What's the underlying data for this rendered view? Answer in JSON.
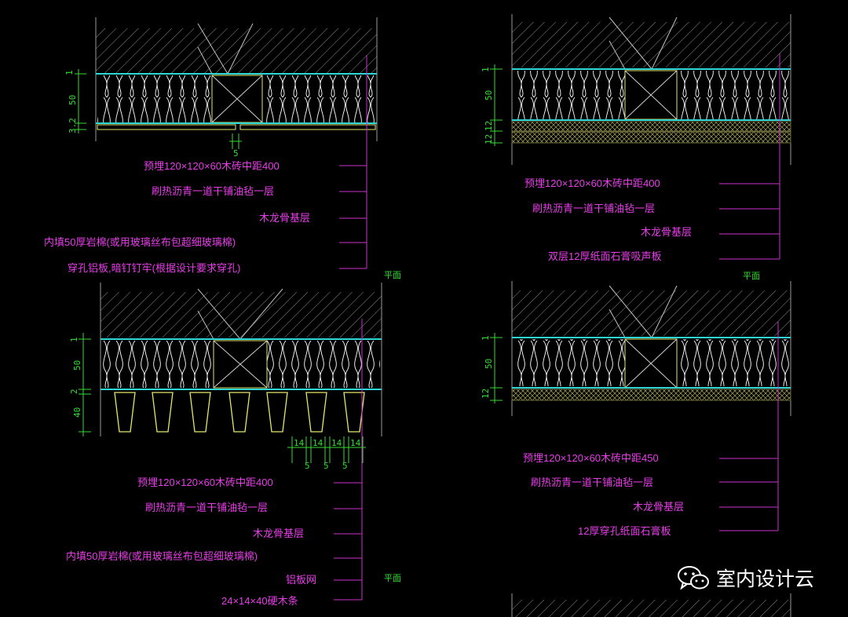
{
  "colors": {
    "background": "#000000",
    "structure": "#9a9a9a",
    "insulation": "#ffffff",
    "membrane": "#2fd6d6",
    "wood": "#e6e66a",
    "leader": "#cc33cc",
    "label": "#e83ee8",
    "dimension": "#33dd33"
  },
  "detailA": {
    "dims": [
      "1",
      "50",
      "3.2"
    ],
    "gap_dim": "5",
    "labels": [
      "预埋120×120×60木砖中距400",
      "刷热沥青一道干铺油毡一层",
      "木龙骨基层",
      "内填50厚岩棉(或用玻璃丝布包超细玻璃棉)",
      "穿孔铝板,暗钉钉牢(根据设计要求穿孔)"
    ],
    "plan_tag": "平面"
  },
  "detailB": {
    "dims": [
      "1",
      "50",
      "12",
      "12"
    ],
    "labels": [
      "预埋120×120×60木砖中距400",
      "刷热沥青一道干铺油毡一层",
      "木龙骨基层",
      "双层12厚纸面石膏吸声板"
    ],
    "plan_tag": "平面"
  },
  "detailC": {
    "dims": [
      "1",
      "50",
      "2",
      "40"
    ],
    "bottom_dims": [
      "14",
      "14",
      "14",
      "14"
    ],
    "bottom_gaps": [
      "5",
      "5",
      "5"
    ],
    "labels": [
      "预埋120×120×60木砖中距400",
      "刷热沥青一道干铺油毡一层",
      "木龙骨基层",
      "内填50厚岩棉(或用玻璃丝布包超细玻璃棉)",
      "铝板网",
      "24×14×40硬木条"
    ],
    "plan_tag": "平面"
  },
  "detailD": {
    "dims": [
      "1",
      "50",
      "12"
    ],
    "labels": [
      "预埋120×120×60木砖中距450",
      "刷热沥青一道干铺油毡一层",
      "木龙骨基层",
      "12厚穿孔纸面石膏板"
    ]
  },
  "watermark": {
    "icon": "wechat-icon",
    "text": "室内设计云"
  }
}
